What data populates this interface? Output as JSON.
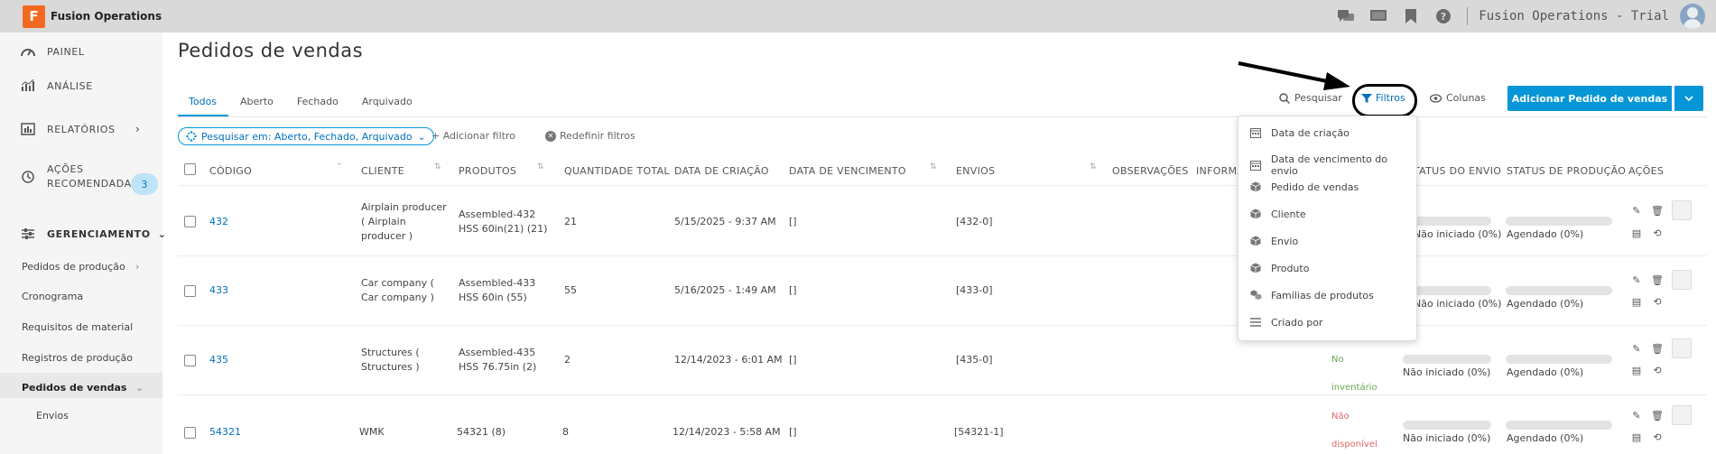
{
  "app": {
    "logo_letter": "F",
    "name": "Fusion Operations",
    "tenant": "Fusion Operations - Trial"
  },
  "top_icons": [
    "chat-icon",
    "screen-icon",
    "bookmark-icon",
    "help-icon"
  ],
  "sidebar": {
    "main_items": [
      {
        "label": "PAINEL",
        "icon": "dashboard-icon"
      },
      {
        "label": "ANÁLISE",
        "icon": "analytics-icon"
      },
      {
        "label": "RELATÓRIOS",
        "icon": "reports-icon"
      },
      {
        "label": "AÇÕES",
        "label2": "RECOMENDADAS",
        "icon": "history-icon",
        "badge": "3"
      },
      {
        "label": "GERENCIAMENTO",
        "icon": "settings-sliders-icon"
      }
    ],
    "sub_items": [
      {
        "label": "Pedidos de produção"
      },
      {
        "label": "Cronograma"
      },
      {
        "label": "Requisitos de material"
      },
      {
        "label": "Registros de produção"
      },
      {
        "label": "Pedidos de vendas"
      },
      {
        "label": "Envios"
      }
    ]
  },
  "page": {
    "title": "Pedidos de vendas"
  },
  "tabs": [
    {
      "label": "Todos"
    },
    {
      "label": "Aberto"
    },
    {
      "label": "Fechado"
    },
    {
      "label": "Arquivado"
    }
  ],
  "toolbar": {
    "search": "Pesquisar",
    "filters": "Filtros",
    "columns": "Colunas",
    "add": "Adicionar Pedido de vendas",
    "search_in": "Pesquisar em: Aberto, Fechado, Arquivado",
    "add_filter": "+ Adicionar filtro",
    "reset_filters": "Redefinir filtros"
  },
  "table": {
    "headers": [
      "CÓDIGO",
      "CLIENTE",
      "PRODUTOS",
      "QUANTIDADE TOTAL",
      "DATA DE CRIAÇÃO",
      "DATA DE VENCIMENTO",
      "ENVIOS",
      "OBSERVAÇÕES",
      "INFORMA",
      "TATUS DO ENVIO",
      "STATUS DE PRODUÇÃO",
      "AÇÕES"
    ],
    "rows": [
      {
        "code": "432",
        "client": [
          "Airplain producer",
          "( Airplain",
          "producer )"
        ],
        "products": [
          "Assembled-432",
          "HSS 60in(21) (21)"
        ],
        "qty": "21",
        "created": "5/15/2025 - 9:37 AM",
        "due": "[]",
        "shipments": "[432-0]",
        "inv": "",
        "ship_status": "Não iniciado (0%)",
        "prod_status": "Agendado (0%)"
      },
      {
        "code": "433",
        "client": [
          "Car company (",
          "Car company )"
        ],
        "products": [
          "Assembled-433",
          "HSS 60in (55)"
        ],
        "qty": "55",
        "created": "5/16/2025 - 1:49 AM",
        "due": "[]",
        "shipments": "[433-0]",
        "inv": "",
        "ship_status": "Não iniciado (0%)",
        "prod_status": "Agendado (0%)"
      },
      {
        "code": "435",
        "client": [
          "Structures (",
          "Structures )"
        ],
        "products": [
          "Assembled-435",
          "HSS 76.75in (2)"
        ],
        "qty": "2",
        "created": "12/14/2023 - 6:01 AM",
        "due": "[]",
        "shipments": "[435-0]",
        "inv": [
          "No",
          "inventário"
        ],
        "ship_status": "Não iniciado (0%)",
        "prod_status": "Agendado (0%)"
      },
      {
        "code": "54321",
        "client": [
          "WMK"
        ],
        "products": [
          "54321 (8)"
        ],
        "qty": "8",
        "created": "12/14/2023 - 5:58 AM",
        "due": "[]",
        "shipments": "[54321-1]",
        "inv": [
          "Não",
          "disponível"
        ],
        "ship_status": "Não iniciado (0%)",
        "prod_status": "Agendado (0%)"
      }
    ]
  },
  "filter_menu": [
    {
      "label": "Data de criação",
      "icon": "calendar-icon"
    },
    {
      "label": "Data de vencimento do envio",
      "icon": "calendar-icon"
    },
    {
      "label": "Pedido de vendas",
      "icon": "cube-icon"
    },
    {
      "label": "Cliente",
      "icon": "cube-icon"
    },
    {
      "label": "Envio",
      "icon": "cube-icon"
    },
    {
      "label": "Produto",
      "icon": "cube-icon"
    },
    {
      "label": "Famílias de produtos",
      "icon": "cubes-icon"
    },
    {
      "label": "Criado por",
      "icon": "list-icon"
    }
  ],
  "colors": {
    "accent": "#0696d7",
    "link": "#0070c0",
    "brand": "#f26a21",
    "green": "#6aa84f",
    "red": "#e06666"
  }
}
